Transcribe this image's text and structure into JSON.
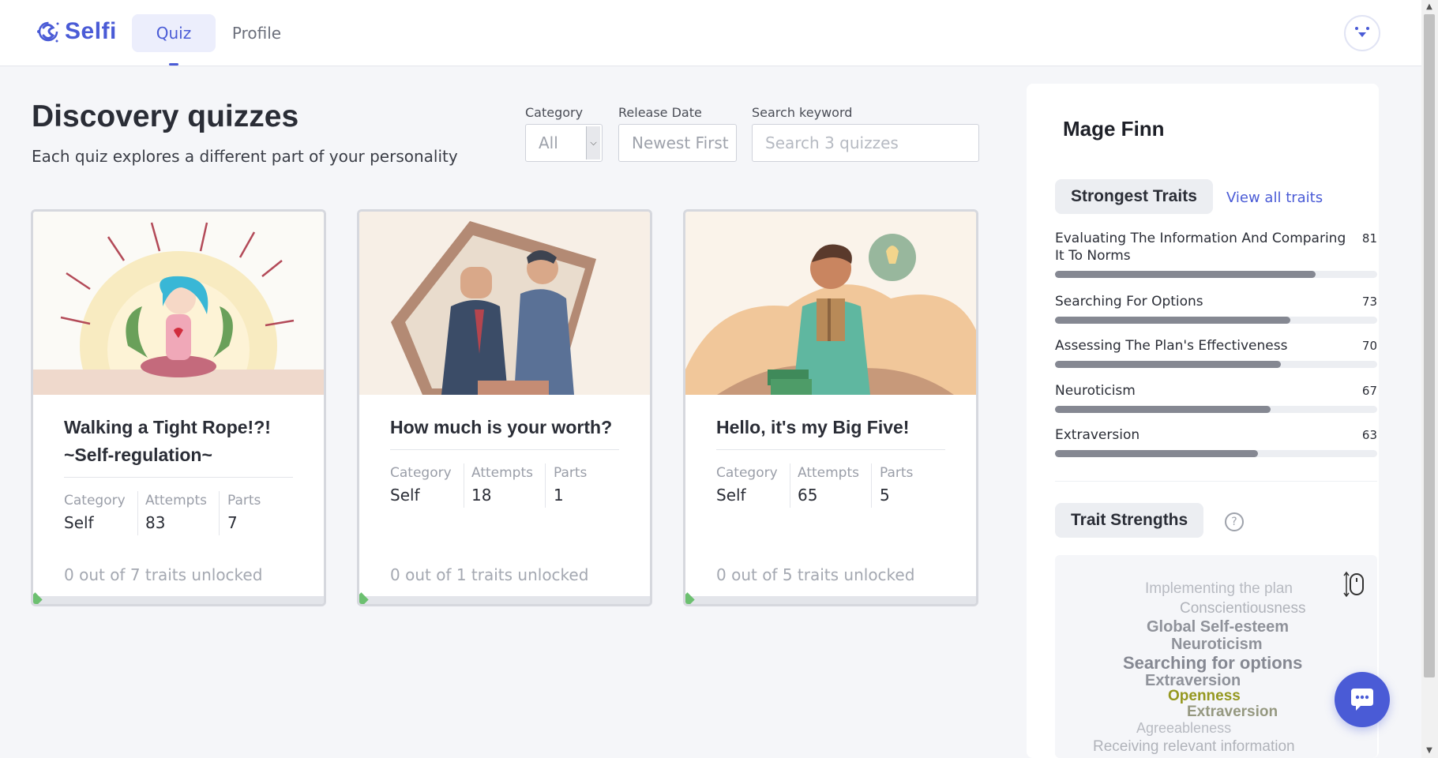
{
  "app": {
    "name": "Selfi",
    "accent": "#4a5bd6"
  },
  "nav": {
    "tabs": [
      {
        "label": "Quiz",
        "active": true
      },
      {
        "label": "Profile",
        "active": false
      }
    ]
  },
  "header": {
    "title": "Discovery quizzes",
    "subtitle": "Each quiz explores a different part of your personality"
  },
  "filters": {
    "category": {
      "label": "Category",
      "value": "All"
    },
    "release": {
      "label": "Release Date",
      "value": "Newest First"
    },
    "search": {
      "label": "Search keyword",
      "placeholder": "Search 3 quizzes"
    }
  },
  "quizzes": [
    {
      "title": "Walking a Tight Rope!?! ~Self-regulation~",
      "category_label": "Category",
      "category": "Self",
      "attempts_label": "Attempts",
      "attempts": "83",
      "parts_label": "Parts",
      "parts": "7",
      "unlocked": "0 out of 7 traits unlocked",
      "progress": 0
    },
    {
      "title": "How much is your worth?",
      "category_label": "Category",
      "category": "Self",
      "attempts_label": "Attempts",
      "attempts": "18",
      "parts_label": "Parts",
      "parts": "1",
      "unlocked": "0 out of 1 traits unlocked",
      "progress": 0
    },
    {
      "title": "Hello, it's my Big Five!",
      "category_label": "Category",
      "category": "Self",
      "attempts_label": "Attempts",
      "attempts": "65",
      "parts_label": "Parts",
      "parts": "5",
      "unlocked": "0 out of 5 traits unlocked",
      "progress": 0
    }
  ],
  "profile": {
    "name": "Mage Finn",
    "strongest_label": "Strongest Traits",
    "view_all": "View all traits",
    "traits": [
      {
        "name": "Evaluating The Information And Comparing It To Norms",
        "score": "81",
        "fraction": 0.81
      },
      {
        "name": "Searching For Options",
        "score": "73",
        "fraction": 0.73
      },
      {
        "name": "Assessing The Plan's Effectiveness",
        "score": "70",
        "fraction": 0.7
      },
      {
        "name": "Neuroticism",
        "score": "67",
        "fraction": 0.67
      },
      {
        "name": "Extraversion",
        "score": "63",
        "fraction": 0.63
      }
    ],
    "strengths_label": "Trait Strengths",
    "help_icon": "?",
    "word_cloud": [
      "Implementing the plan",
      "Conscientiousness",
      "Global Self-esteem",
      "Neuroticism",
      "Searching for options",
      "Extraversion",
      "Openness",
      "Extraversion",
      "Agreeableness",
      "Receiving relevant information"
    ]
  }
}
